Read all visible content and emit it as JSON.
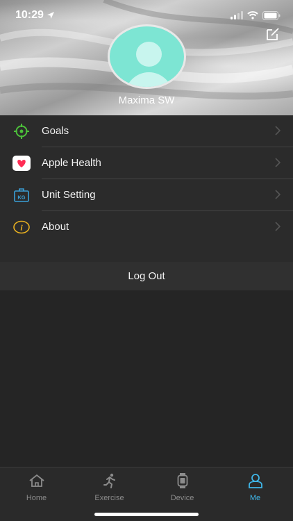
{
  "status_bar": {
    "time": "10:29",
    "location_icon": "location-arrow-icon",
    "signal_icon": "cellular-signal-icon",
    "wifi_icon": "wifi-icon",
    "battery_icon": "battery-icon"
  },
  "header": {
    "edit_icon": "edit-icon",
    "username": "Maxima SW",
    "avatar_color": "#7de5d3"
  },
  "menu": {
    "items": [
      {
        "label": "Goals",
        "icon": "target-icon",
        "icon_color": "#4cbf3a"
      },
      {
        "label": "Apple Health",
        "icon": "heart-icon",
        "icon_color": "#ff2d55"
      },
      {
        "label": "Unit Setting",
        "icon": "scale-kg-icon",
        "icon_color": "#3aa0d8"
      },
      {
        "label": "About",
        "icon": "info-icon",
        "icon_color": "#e8b020"
      }
    ]
  },
  "logout": {
    "label": "Log Out"
  },
  "tabbar": {
    "accent": "#3fb6e8",
    "tabs": [
      {
        "label": "Home",
        "icon": "home-icon",
        "active": false
      },
      {
        "label": "Exercise",
        "icon": "running-icon",
        "active": false
      },
      {
        "label": "Device",
        "icon": "watch-icon",
        "active": false
      },
      {
        "label": "Me",
        "icon": "person-icon",
        "active": true
      }
    ]
  }
}
